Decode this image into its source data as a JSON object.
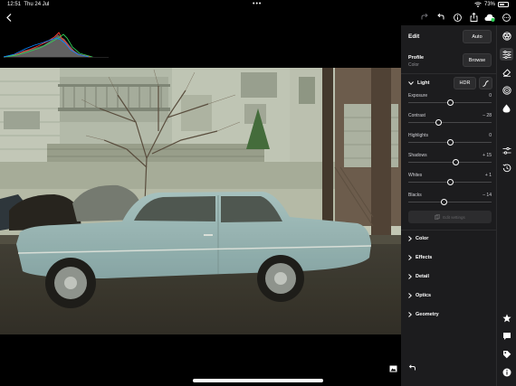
{
  "status_bar": {
    "time": "12:51",
    "date": "Thu 24 Jul",
    "dots": "•••",
    "battery_pct": "73%",
    "battery_level": 0.73
  },
  "panel": {
    "title": "Edit",
    "auto_label": "Auto",
    "profile_label": "Profile",
    "profile_value": "Color",
    "browse_label": "Browse",
    "light": {
      "label": "Light",
      "hdr_label": "HDR",
      "sliders": [
        {
          "label": "Exposure",
          "value": "0",
          "position": 0.5
        },
        {
          "label": "Contrast",
          "value": "– 28",
          "position": 0.36
        },
        {
          "label": "Highlights",
          "value": "0",
          "position": 0.5
        },
        {
          "label": "Shadows",
          "value": "+ 15",
          "position": 0.575
        },
        {
          "label": "Whites",
          "value": "+ 1",
          "position": 0.505
        },
        {
          "label": "Blacks",
          "value": "– 14",
          "position": 0.43
        }
      ],
      "edit_settings_label": "Edit settings"
    },
    "sections": [
      "Color",
      "Effects",
      "Detail",
      "Optics",
      "Geometry"
    ]
  },
  "colors": {
    "panel_bg": "#1c1c1e",
    "accent_green": "#30d158"
  },
  "icons": {
    "back": "chevron-left-icon",
    "redo": "redo-icon",
    "undo": "undo-icon",
    "info": "info-icon",
    "share": "share-icon",
    "cloud": "cloud-sync-icon",
    "more": "more-icon",
    "tools": [
      "presets-icon",
      "edit-sliders-icon",
      "eraser-icon",
      "masking-icon",
      "healing-icon",
      "versions-icon",
      "history-icon",
      "star-icon",
      "comment-icon",
      "tag-icon",
      "info-icon"
    ]
  }
}
